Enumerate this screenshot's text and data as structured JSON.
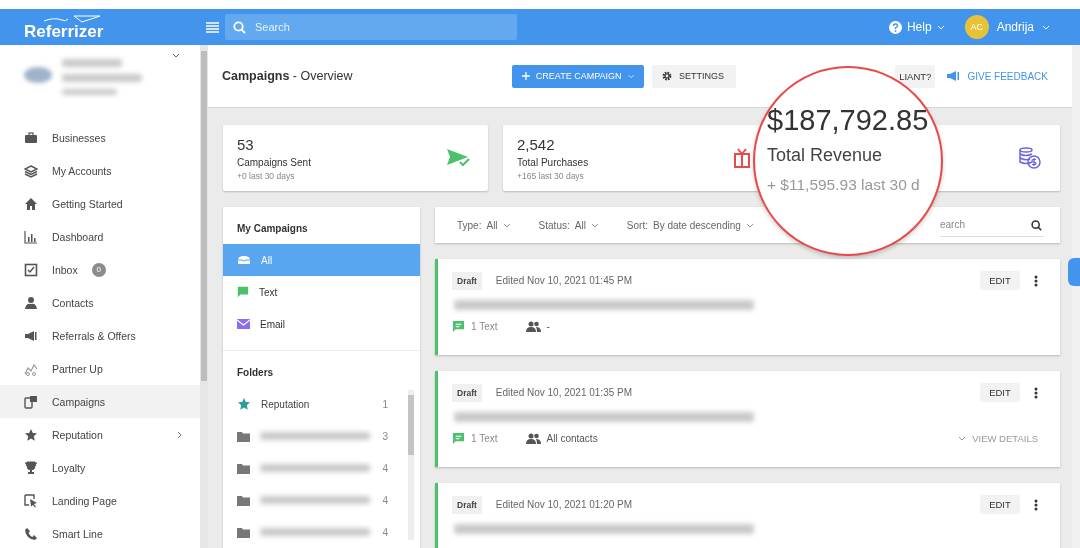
{
  "header": {
    "logo": "Referrizer",
    "search": {
      "placeholder": "Search"
    },
    "help": "Help",
    "user": {
      "initials": "AC",
      "name": "Andrija"
    }
  },
  "sidebar": {
    "items": [
      {
        "label": "Businesses",
        "selected": false,
        "has_submenu": false
      },
      {
        "label": "My Accounts",
        "selected": false,
        "has_submenu": false
      },
      {
        "label": "Getting Started",
        "selected": false,
        "has_submenu": false
      },
      {
        "label": "Dashboard",
        "selected": false,
        "has_submenu": false
      },
      {
        "label": "Inbox",
        "selected": false,
        "has_submenu": false,
        "badge": "0"
      },
      {
        "label": "Contacts",
        "selected": false,
        "has_submenu": false
      },
      {
        "label": "Referrals & Offers",
        "selected": false,
        "has_submenu": false
      },
      {
        "label": "Partner Up",
        "selected": false,
        "has_submenu": false
      },
      {
        "label": "Campaigns",
        "selected": true,
        "has_submenu": false
      },
      {
        "label": "Reputation",
        "selected": false,
        "has_submenu": true
      },
      {
        "label": "Loyalty",
        "selected": false,
        "has_submenu": false
      },
      {
        "label": "Landing Page",
        "selected": false,
        "has_submenu": false
      },
      {
        "label": "Smart Line",
        "selected": false,
        "has_submenu": false
      }
    ]
  },
  "page": {
    "title": "**Campaigns** - Overview",
    "buttons": [
      {
        "kind": "primary",
        "label": "CREATE CAMPAIGN"
      },
      {
        "kind": "settings",
        "label": "SETTINGS"
      },
      {
        "kind": "plain",
        "label": "LIANT?"
      },
      {
        "kind": "link",
        "label": "GIVE FEEDBACK"
      }
    ]
  },
  "stats": [
    {
      "value": "53",
      "label": "Campaigns Sent",
      "delta": "+0 last 30 days"
    },
    {
      "value": "2,542",
      "label": "Total Purchases",
      "delta": "+165 last 30 days"
    }
  ],
  "magnifier": {
    "value": "$187,792.85",
    "label": "Total Revenue",
    "delta": "+ $11,595.93 last 30 d"
  },
  "my_campaigns": {
    "title": "My Campaigns",
    "filters": [
      {
        "label": "All",
        "selected": true
      },
      {
        "label": "Text",
        "selected": false
      },
      {
        "label": "Email",
        "selected": false
      }
    ]
  },
  "folders": {
    "title": "Folders",
    "items": [
      {
        "kind": "star",
        "name": "Reputation",
        "count": "1"
      },
      {
        "kind": "folder",
        "count": "3"
      },
      {
        "kind": "folder",
        "count": "4"
      },
      {
        "kind": "folder",
        "count": "4"
      },
      {
        "kind": "folder",
        "count": "4"
      }
    ]
  },
  "filter_bar": {
    "filters": [
      {
        "label": "Type:",
        "value": "All"
      },
      {
        "label": "Status:",
        "value": "All"
      },
      {
        "label": "Sort:",
        "value": "By date descending"
      }
    ],
    "search_placeholder": "earch"
  },
  "campaigns": [
    {
      "status": "Draft",
      "edited": "Edited Nov 10, 2021 01:45 PM",
      "edit": "EDIT",
      "messages": "1 Text",
      "audience": "-"
    },
    {
      "status": "Draft",
      "edited": "Edited Nov 10, 2021 01:35 PM",
      "edit": "EDIT",
      "messages": "1 Text",
      "audience": "All contacts",
      "details": "VIEW DETAILS"
    },
    {
      "status": "Draft",
      "edited": "Edited Nov 10, 2021 01:20 PM",
      "edit": "EDIT"
    }
  ]
}
